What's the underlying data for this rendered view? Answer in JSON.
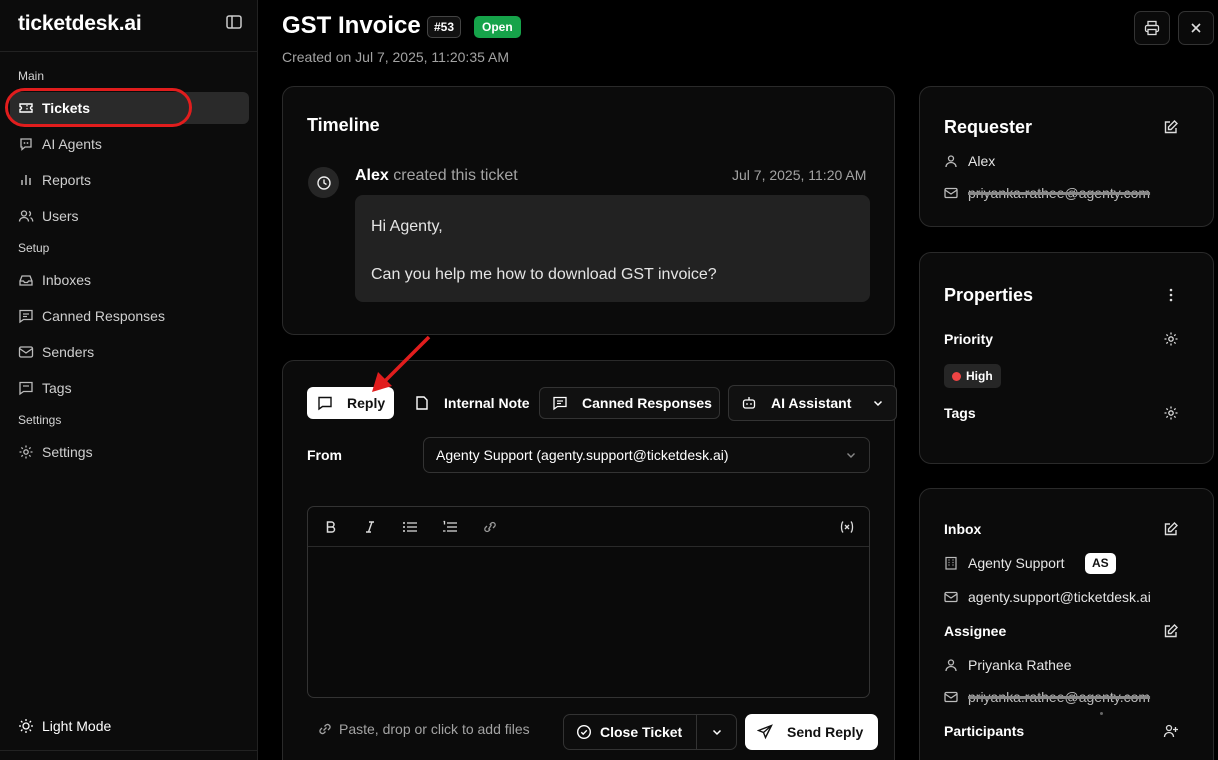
{
  "app": {
    "brand": "ticketdesk.ai"
  },
  "sidebar": {
    "sections": {
      "main": "Main",
      "setup": "Setup",
      "settings": "Settings"
    },
    "items": [
      {
        "label": "Tickets",
        "icon": "ticket-icon"
      },
      {
        "label": "AI Agents",
        "icon": "bot-message-icon"
      },
      {
        "label": "Reports",
        "icon": "bar-chart-icon"
      },
      {
        "label": "Users",
        "icon": "users-icon"
      },
      {
        "label": "Inboxes",
        "icon": "inbox-icon"
      },
      {
        "label": "Canned Responses",
        "icon": "message-square-icon"
      },
      {
        "label": "Senders",
        "icon": "mail-icon"
      },
      {
        "label": "Tags",
        "icon": "tag-message-icon"
      },
      {
        "label": "Settings",
        "icon": "gear-icon"
      }
    ],
    "footer": {
      "light_mode": "Light Mode"
    }
  },
  "ticket": {
    "title": "GST Invoice",
    "number": "#53",
    "status": "Open",
    "created": "Created on Jul 7, 2025, 11:20:35 AM"
  },
  "timeline": {
    "title": "Timeline",
    "event": {
      "author": "Alex",
      "action": "created this ticket",
      "time": "Jul 7, 2025, 11:20 AM",
      "message_line1": "Hi Agenty,",
      "message_line2": "Can you help me how to download GST invoice?"
    }
  },
  "composer": {
    "tabs": {
      "reply": "Reply",
      "internal_note": "Internal Note",
      "canned": "Canned Responses",
      "ai": "AI Assistant"
    },
    "from_label": "From",
    "from_value": "Agenty Support (agenty.support@ticketdesk.ai)",
    "attach_hint": "Paste, drop or click to add files",
    "close_ticket": "Close Ticket",
    "send_reply": "Send Reply"
  },
  "requester": {
    "title": "Requester",
    "name": "Alex",
    "email": "priyanka.rathee@agenty.com"
  },
  "properties": {
    "title": "Properties",
    "priority_label": "Priority",
    "priority_value": "High",
    "tags_label": "Tags"
  },
  "details": {
    "inbox_label": "Inbox",
    "inbox_name": "Agenty Support",
    "inbox_badge": "AS",
    "inbox_email": "agenty.support@ticketdesk.ai",
    "assignee_label": "Assignee",
    "assignee_name": "Priyanka Rathee",
    "assignee_email": "priyanka.rathee@agenty.com",
    "participants_label": "Participants"
  },
  "colors": {
    "accent": "#16a34a",
    "highlight": "#e11d1d",
    "priority_high": "#ef4444"
  }
}
